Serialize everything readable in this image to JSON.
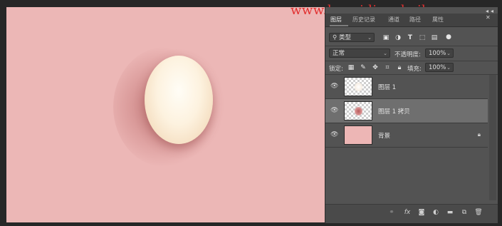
{
  "watermark": "www.haoyidianshejl.com",
  "window_controls": "◂◂ ✕",
  "tabs": [
    {
      "label": "图层",
      "active": true
    },
    {
      "label": "历史记录",
      "active": false
    },
    {
      "label": "通道",
      "active": false
    },
    {
      "label": "路径",
      "active": false
    },
    {
      "label": "属性",
      "active": false
    }
  ],
  "filter": {
    "icon": "search-icon",
    "label": "类型",
    "arrow": "⌄"
  },
  "filter_icons": [
    "image-filter-icon",
    "adjustment-filter-icon",
    "type-filter-icon",
    "shape-filter-icon",
    "smartobject-filter-icon"
  ],
  "blend": {
    "mode": "正常",
    "opacity_label": "不透明度:",
    "opacity_value": "100%"
  },
  "lock": {
    "label": "锁定:",
    "fill_label": "填充:",
    "fill_value": "100%"
  },
  "layers": [
    {
      "name": "图层 1",
      "visible": true,
      "selected": false,
      "thumb": "egg-transparent"
    },
    {
      "name": "图层 1 拷贝",
      "visible": true,
      "selected": true,
      "thumb": "shadow-transparent"
    },
    {
      "name": "背景",
      "visible": true,
      "selected": false,
      "thumb": "pink-fill",
      "locked": true
    }
  ],
  "bottom_icons": [
    "link-icon",
    "fx-icon",
    "mask-icon",
    "adjustment-icon",
    "group-folder-icon",
    "new-layer-icon",
    "trash-icon"
  ],
  "bottom_fx_label": "fx",
  "colors": {
    "canvas": "#ecb7b6",
    "panel": "#535353",
    "selected_layer": "#6f6f6f",
    "watermark": "#e23030"
  }
}
